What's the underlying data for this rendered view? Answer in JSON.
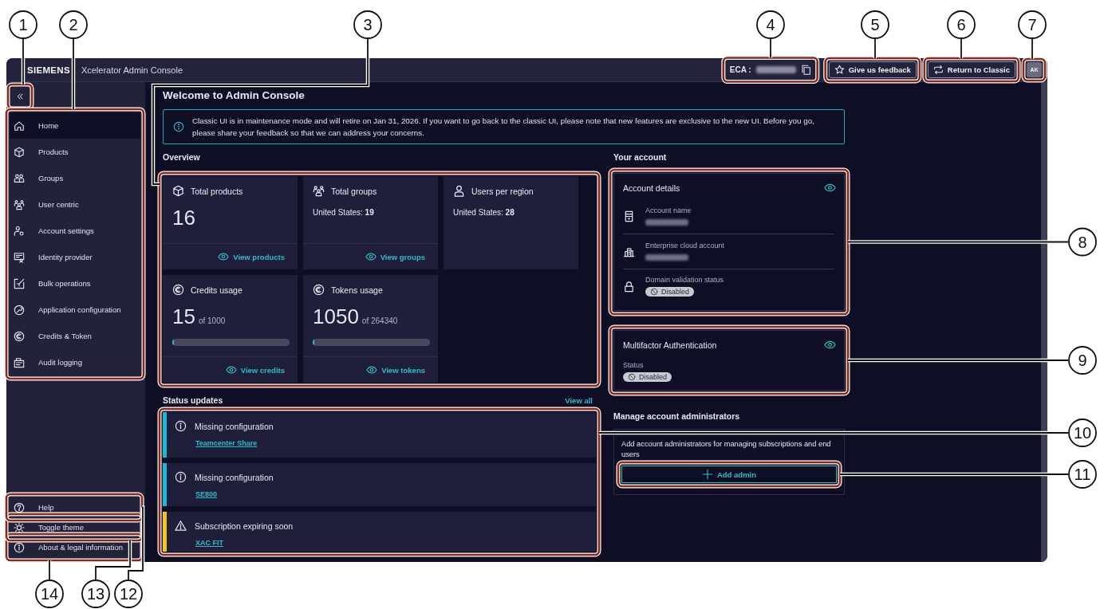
{
  "window": {
    "brand": "SIEMENS",
    "title": "Xcelerator Admin Console"
  },
  "header": {
    "eca_label": "ECA :",
    "feedback": "Give us feedback",
    "return": "Return to Classic",
    "avatar": "AK"
  },
  "sidebar": {
    "items": [
      {
        "label": "Home",
        "selected": true
      },
      {
        "label": "Products",
        "selected": false
      },
      {
        "label": "Groups",
        "selected": false
      },
      {
        "label": "User centric",
        "selected": false
      },
      {
        "label": "Account settings",
        "selected": false
      },
      {
        "label": "Identity provider",
        "selected": false
      },
      {
        "label": "Bulk operations",
        "selected": false
      },
      {
        "label": "Application configuration",
        "selected": false
      },
      {
        "label": "Credits & Token",
        "selected": false
      },
      {
        "label": "Audit logging",
        "selected": false
      }
    ],
    "footer": [
      "Help",
      "Toggle theme",
      "About & legal information"
    ]
  },
  "page": {
    "title": "Welcome to Admin Console",
    "banner": "Classic UI is in maintenance mode and will retire on Jan 31, 2026. If you want to go back to the classic UI, please note that new features are exclusive to the new UI. Before you go, please share your feedback so that we can address your concerns."
  },
  "overview": {
    "heading": "Overview",
    "cards": [
      {
        "kind": "count",
        "title": "Total products",
        "value": "16",
        "link": "View products"
      },
      {
        "kind": "region",
        "title": "Total groups",
        "detail": "United States: **19**",
        "link": "View groups"
      },
      {
        "kind": "region",
        "title": "Users per region",
        "detail": "United States: **28**"
      },
      {
        "kind": "usage",
        "title": "Credits usage",
        "value": "15",
        "total": "of 1000",
        "level": 0.015,
        "link": "View credits"
      },
      {
        "kind": "usage",
        "title": "Tokens usage",
        "value": "1050",
        "total": "of 264340",
        "level": 0.004,
        "link": "View tokens"
      }
    ]
  },
  "status_updates": {
    "heading": "Status updates",
    "view_all": "View all",
    "items": [
      {
        "kind": "info",
        "color": "#17b9d6",
        "title": "Missing configuration",
        "link": "Teamcenter Share"
      },
      {
        "kind": "info",
        "color": "#17b9d6",
        "title": "Missing configuration",
        "link": "SE800"
      },
      {
        "kind": "warning",
        "color": "#f4c21c",
        "title": "Subscription expiring soon",
        "link": "XAC FIT"
      }
    ]
  },
  "account": {
    "heading": "Your account",
    "details": {
      "title": "Account details",
      "fields": [
        {
          "kind": "hidden",
          "label": "Account name"
        },
        {
          "kind": "hidden",
          "label": "Enterprise cloud account"
        },
        {
          "kind": "badge",
          "label": "Domain validation status",
          "badge": "Disabled"
        }
      ]
    },
    "mfa": {
      "title": "Multifactor Authentication",
      "status_label": "Status",
      "badge": "Disabled"
    }
  },
  "admins": {
    "heading": "Manage account administrators",
    "text": "Add account administrators for managing subscriptions and end users",
    "button": "Add admin"
  },
  "callouts": [
    "1",
    "2",
    "3",
    "4",
    "5",
    "6",
    "7",
    "8",
    "9",
    "10",
    "11",
    "14",
    "13",
    "12"
  ]
}
